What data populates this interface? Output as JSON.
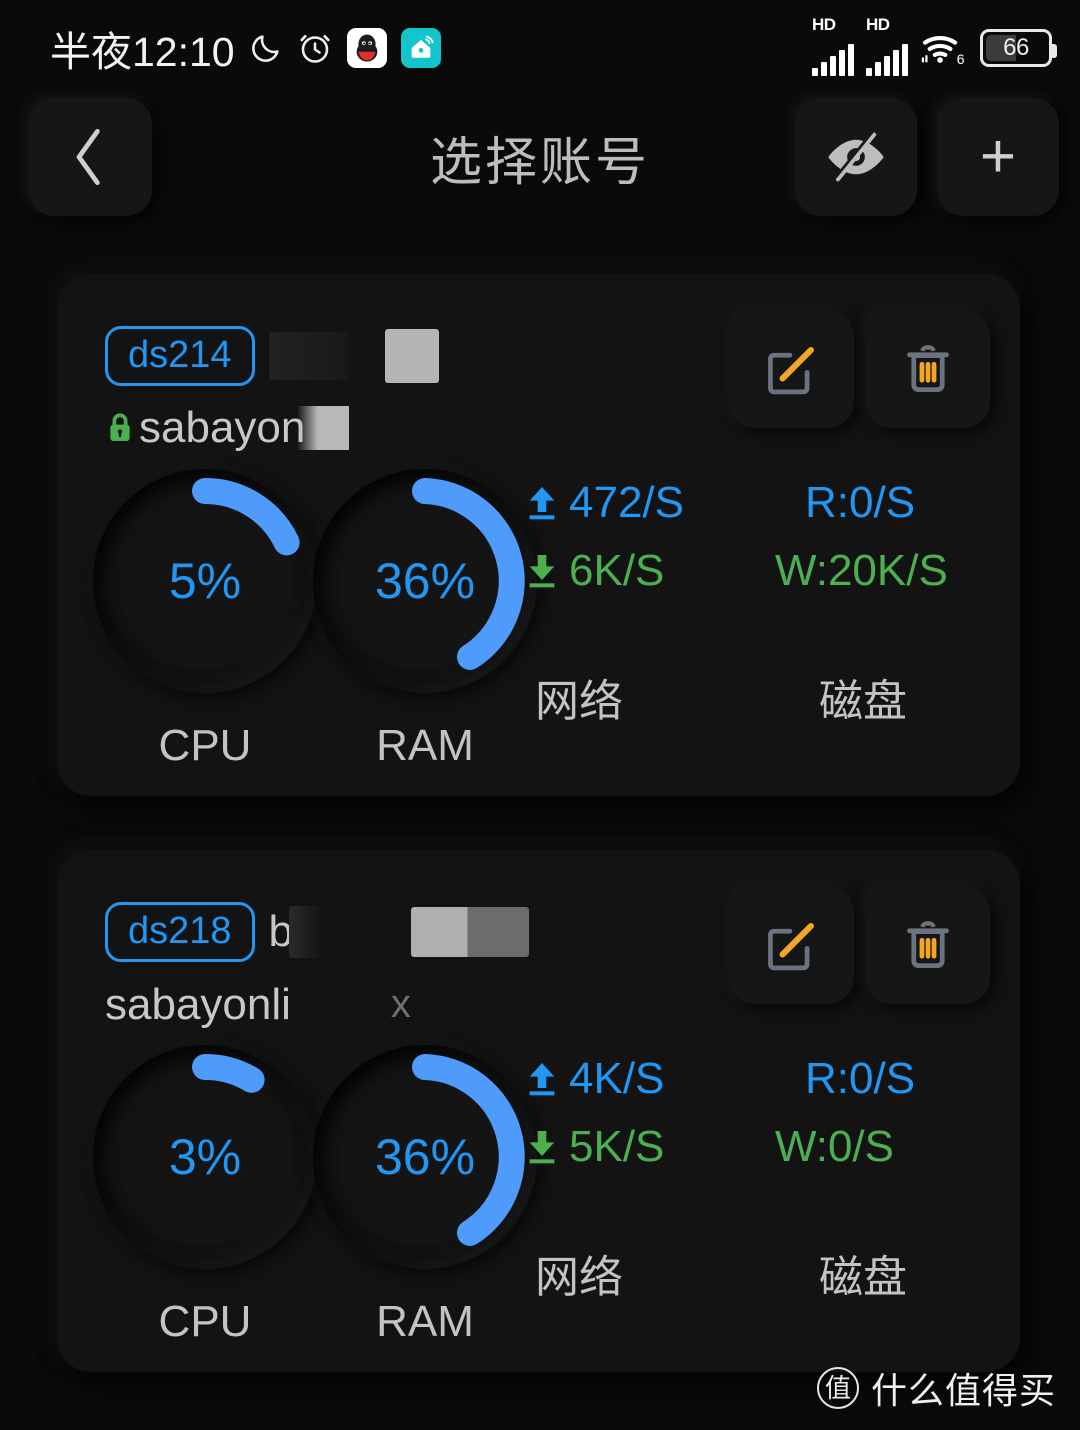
{
  "statusbar": {
    "time": "半夜12:10",
    "icons_left": [
      "moon-icon",
      "alarm-icon",
      "qq-icon",
      "app-icon"
    ],
    "signal1_label": "HD",
    "signal2_label": "HD",
    "wifi_label": "6",
    "battery_level": "66"
  },
  "header": {
    "title": "选择账号",
    "back_label": "‹",
    "eye_off_label": "eye-off-icon",
    "add_label": "+"
  },
  "accounts": [
    {
      "model_badge": "ds214",
      "secure": true,
      "hostname": "sabayon",
      "extra_mark": "",
      "cpu": {
        "value": "5%",
        "percent": 5,
        "label": "CPU"
      },
      "ram": {
        "value": "36%",
        "percent": 36,
        "label": "RAM"
      },
      "network": {
        "label": "网络",
        "upload": "472/S",
        "download": "6K/S"
      },
      "disk": {
        "label": "磁盘",
        "read": "R:0/S",
        "write": "W:20K/S"
      },
      "edit_label": "edit-icon",
      "delete_label": "trash-icon"
    },
    {
      "model_badge": "ds218",
      "secure": false,
      "hostname": "sabayonli",
      "extra_mark": "x",
      "cpu": {
        "value": "3%",
        "percent": 3,
        "label": "CPU"
      },
      "ram": {
        "value": "36%",
        "percent": 36,
        "label": "RAM"
      },
      "network": {
        "label": "网络",
        "upload": "4K/S",
        "download": "5K/S"
      },
      "disk": {
        "label": "磁盘",
        "read": "R:0/S",
        "write": "W:0/S"
      },
      "edit_label": "edit-icon",
      "delete_label": "trash-icon"
    }
  ],
  "watermark": {
    "logo_char": "值",
    "text": "什么值得买"
  },
  "colors": {
    "accent_blue": "#2196f3",
    "accent_green": "#4caf50",
    "accent_orange": "#f5a623",
    "card_bg": "#131313",
    "page_bg": "#0a0a0a"
  }
}
